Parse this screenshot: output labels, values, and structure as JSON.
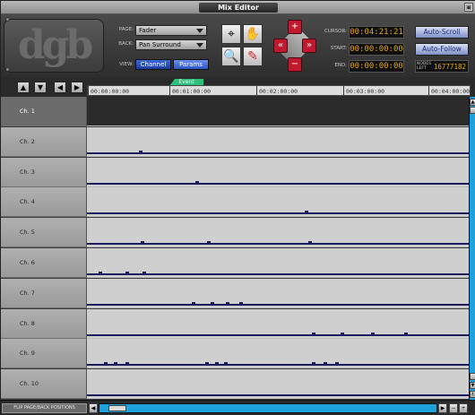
{
  "window": {
    "title": "Mix Editor"
  },
  "logo": {
    "text": "dgb"
  },
  "controls": {
    "page_label": "PAGE:",
    "page_value": "Fader",
    "back_label": "BACK:",
    "back_value": "Pan Surround",
    "view_label": "VIEW:",
    "view_channel": "Channel",
    "view_params": "Params"
  },
  "time": {
    "cursor_label": "CURSOR:",
    "cursor_value": "00:04:21:21",
    "start_label": "START:",
    "start_value": "00:00:00:00",
    "end_label": "END:",
    "end_value": "00:00:00:00"
  },
  "right": {
    "auto_scroll": "Auto-Scroll",
    "auto_follow": "Auto-Follow",
    "nodes_label": "NODES LEFT",
    "nodes_value": "16777182"
  },
  "ruler": {
    "event_label": "Event",
    "ticks": [
      "00:00:00:00",
      "00:01:00:00",
      "00:02:00:00",
      "00:03:00:00",
      "00:04:00:00"
    ]
  },
  "tracks": [
    {
      "name": "Ch. 1",
      "selected": true,
      "events": []
    },
    {
      "name": "Ch. 2",
      "selected": false,
      "events": [
        0.135
      ]
    },
    {
      "name": "Ch. 3",
      "selected": false,
      "events": [
        0.285
      ]
    },
    {
      "name": "Ch. 4",
      "selected": false,
      "events": [
        0.57
      ]
    },
    {
      "name": "Ch. 5",
      "selected": false,
      "events": [
        0.14,
        0.315,
        0.58
      ]
    },
    {
      "name": "Ch. 6",
      "selected": false,
      "events": [
        0.03,
        0.1,
        0.145
      ]
    },
    {
      "name": "Ch. 7",
      "selected": false,
      "events": [
        0.275,
        0.325,
        0.365,
        0.4
      ]
    },
    {
      "name": "Ch. 8",
      "selected": false,
      "events": [
        0.59,
        0.665,
        0.745,
        0.83
      ]
    },
    {
      "name": "Ch. 9",
      "selected": false,
      "events": [
        0.045,
        0.07,
        0.1,
        0.31,
        0.335,
        0.36,
        0.59,
        0.62,
        0.65
      ]
    },
    {
      "name": "Ch. 10",
      "selected": false,
      "events": []
    }
  ],
  "bottom": {
    "flip_label": "FLIP PAGE/BACK POSITIONS"
  }
}
